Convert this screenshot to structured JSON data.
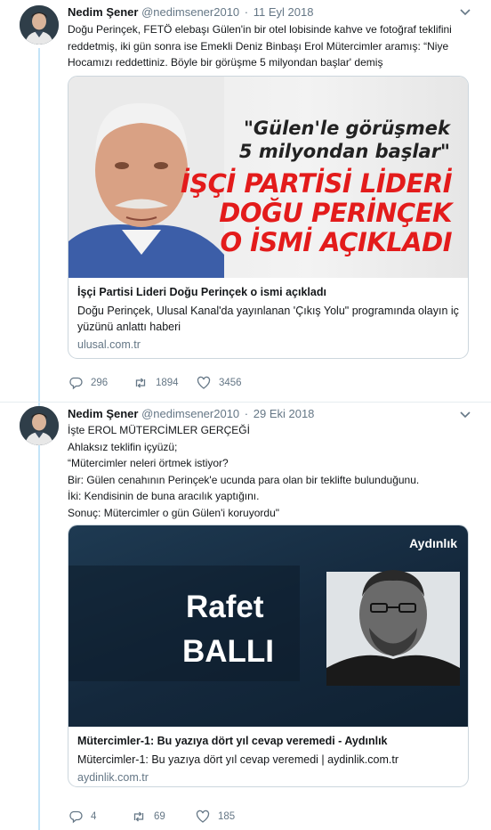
{
  "tweets": [
    {
      "author": {
        "name": "Nedim Şener",
        "handle": "@nedimsener2010"
      },
      "separator": "·",
      "date": "11 Eyl 2018",
      "text_lines": [
        "Doğu Perinçek, FETÖ elebaşı Gülen'in bir otel lobisinde kahve ve fotoğraf teklifini",
        "reddetmiş, iki gün sonra ise Emekli Deniz Binbaşı Erol Mütercimler aramış: “Niye",
        "Hocamızı reddettiniz. Böyle bir görüşme 5 milyondan başlar' demiş"
      ],
      "card": {
        "image_text": {
          "quote_line1": "\"Gülen'le görüşmek",
          "quote_line2": "5 milyondan başlar\"",
          "red_line1": "İŞÇİ PARTİSİ LİDERİ",
          "red_line2": "DOĞU PERİNÇEK",
          "red_line3": "O İSMİ AÇIKLADI"
        },
        "title": "İşçi Partisi Lideri Doğu Perinçek o ismi açıkladı",
        "description": "Doğu Perinçek, Ulusal Kanal'da yayınlanan 'Çıkış Yolu\" programında olayın iç yüzünü anlattı haberi",
        "domain": "ulusal.com.tr"
      },
      "stats": {
        "replies": "296",
        "retweets": "1894",
        "likes": "3456"
      }
    },
    {
      "author": {
        "name": "Nedim Şener",
        "handle": "@nedimsener2010"
      },
      "separator": "·",
      "date": "29 Eki 2018",
      "text_lines": [
        "İşte EROL MÜTERCİMLER GERÇEĞİ",
        "Ahlaksız teklifin içyüzü;",
        "“Mütercimler neleri örtmek istiyor?",
        "Bir: Gülen cenahının Perinçek'e ucunda para olan bir teklifte bulunduğunu.",
        "İki: Kendisinin de buna aracılık yaptığını.",
        "Sonuç: Mütercimler o gün Gülen'i koruyordu\""
      ],
      "card": {
        "image_text": {
          "brand": "Aydınlık",
          "first_name": "Rafet",
          "last_name": "BALLI"
        },
        "title": "Mütercimler-1: Bu yazıya dört yıl cevap veremedi - Aydınlık",
        "description": "Mütercimler-1: Bu yazıya dört yıl cevap veremedi | aydinlik.com.tr",
        "domain": "aydinlik.com.tr"
      },
      "stats": {
        "replies": "4",
        "retweets": "69",
        "likes": "185"
      }
    }
  ],
  "colors": {
    "accent_thread": "#c4e4f7",
    "muted_text": "#657786",
    "headline_red": "#e31b1b",
    "card_border": "#ccd6dd"
  },
  "icons": [
    "avatar",
    "chevron-down-icon",
    "reply-icon",
    "retweet-icon",
    "like-icon"
  ]
}
